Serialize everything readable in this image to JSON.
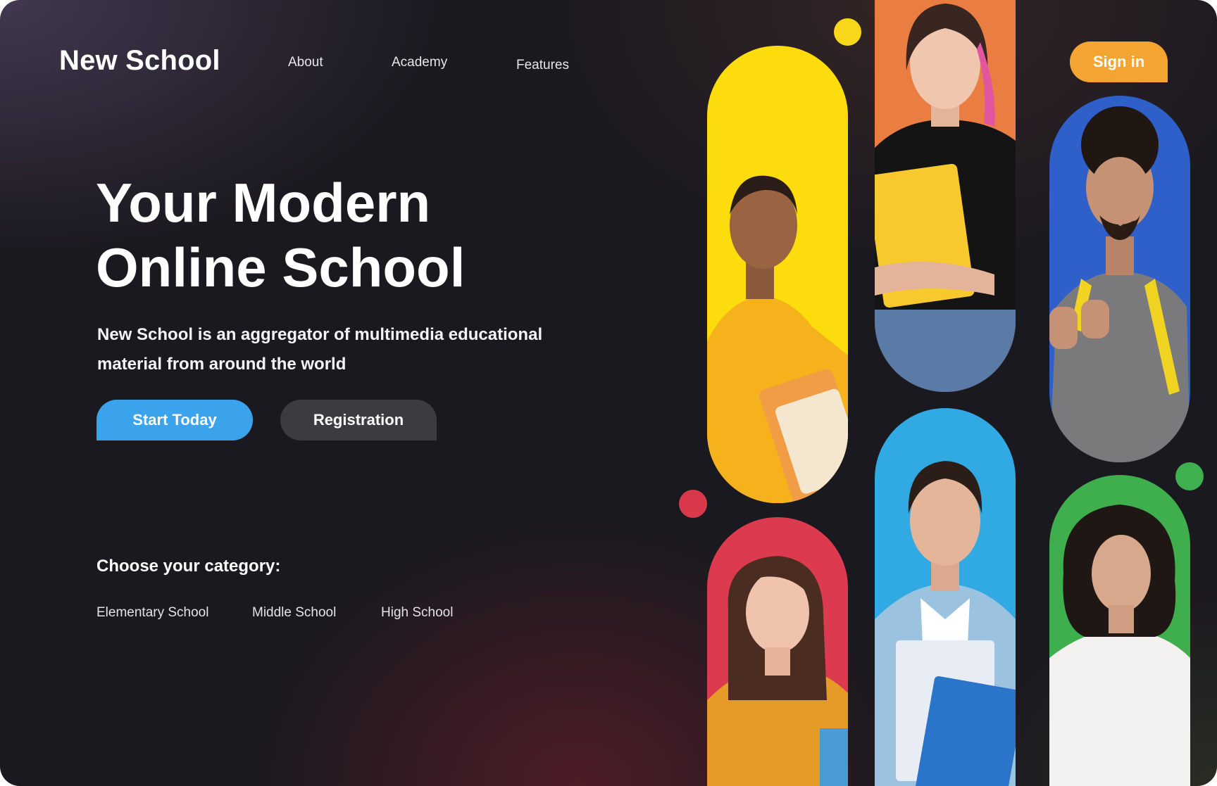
{
  "brand": {
    "name": "New School"
  },
  "nav": {
    "items": [
      "About",
      "Academy",
      "Features"
    ]
  },
  "header": {
    "signin_label": "Sign in"
  },
  "hero": {
    "title_line1": "Your Modern",
    "title_line2": "Online School",
    "subtitle": "New School is an aggregator of multimedia educational material from around the world",
    "start_label": "Start Today",
    "registration_label": "Registration"
  },
  "categories": {
    "title": "Choose your category:",
    "items": [
      "Elementary School",
      "Middle School",
      "High School"
    ]
  },
  "colors": {
    "accent_orange": "#f4a531",
    "accent_blue": "#3ba3ec",
    "button_dark": "#3c3b40",
    "pill_yellow": "#fcdc0c",
    "pill_orange": "#ea7d42",
    "pill_blue": "#2f5fc9",
    "pill_red": "#dc3a4f",
    "pill_cyan": "#31a9e2",
    "pill_green": "#3fae4d"
  }
}
